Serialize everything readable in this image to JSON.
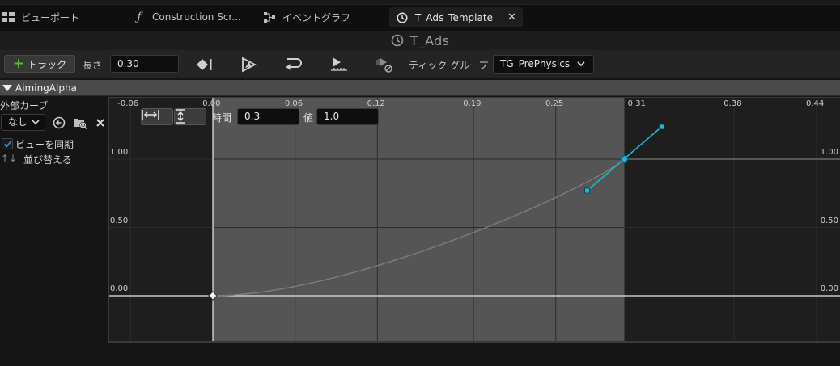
{
  "tabs": [
    {
      "label": "ビューポート",
      "icon": "viewport-grid-icon"
    },
    {
      "label": "Construction Scr...",
      "icon": "function-icon"
    },
    {
      "label": "イベントグラフ",
      "icon": "event-graph-icon"
    },
    {
      "label": "T_Ads_Template",
      "icon": "timeline-clock-icon",
      "active": true
    }
  ],
  "close_symbol": "✕",
  "title": "T_Ads",
  "toolbar": {
    "add_track_label": "トラック",
    "length_label": "長さ",
    "length_value": "0.30",
    "tick_group_label": "ティック グループ",
    "tick_group_value": "TG_PrePhysics"
  },
  "track": {
    "name": "AimingAlpha",
    "external_curve_label": "外部カーブ",
    "external_curve_value": "なし",
    "sync_view_label": "ビューを同期",
    "sync_view_checked": true,
    "sort_label": "並び替える",
    "sort_icon": "↑↓"
  },
  "graph": {
    "time_label": "時間",
    "time_value": "0.3",
    "value_label": "値",
    "value_value": "1.0",
    "x_ticks": [
      "-0.06",
      "0.00",
      "0.06",
      "0.12",
      "0.19",
      "0.25",
      "0.31",
      "0.38",
      "0.44"
    ],
    "y_ticks": [
      "1.00",
      "0.50",
      "0.00"
    ],
    "accent_color": "#1fb6d2",
    "range_fill_color": "#555555",
    "keys": [
      {
        "time": 0.0,
        "value": 0.0
      },
      {
        "time": 0.3,
        "value": 1.0
      }
    ]
  }
}
